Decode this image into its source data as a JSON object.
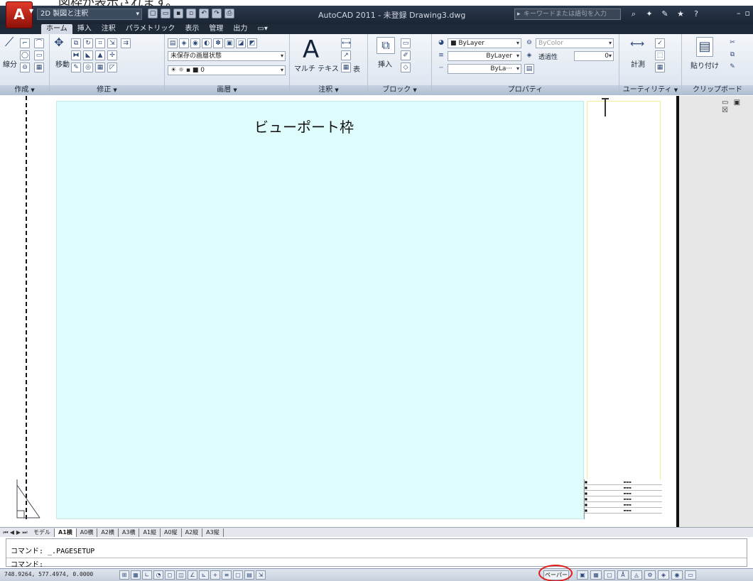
{
  "caption": "図枠が表示されます。",
  "titlebar": {
    "workspace": "2D 製図と注釈",
    "title": "AutoCAD 2011 - 未登録   Drawing3.dwg",
    "search_placeholder": "キーワードまたは語句を入力",
    "app_button": "A"
  },
  "tabs": [
    "ホーム",
    "挿入",
    "注釈",
    "パラメトリック",
    "表示",
    "管理",
    "出力"
  ],
  "ribbon": {
    "draw_panel": "作成",
    "draw_line": "線分",
    "modify_panel": "修正",
    "move": "移動",
    "layers_panel": "画層",
    "layer_state": "未保存の画層状態",
    "layer_current": "0",
    "annotation_panel": "注釈",
    "mtext": "マルチ テキスト",
    "table": "表",
    "block_panel": "ブロック",
    "insert": "挿入",
    "properties_panel": "プロパティ",
    "color": "ByLayer",
    "bycolor": "ByColor",
    "lineweight": "ByLayer",
    "linetype": "ByLa···",
    "transparency": "透過性",
    "transparency_value": "0",
    "utilities_panel": "ユーティリティ",
    "measure": "計測",
    "clipboard_panel": "クリップボード",
    "paste": "貼り付け"
  },
  "drawing": {
    "viewport_label": "ビューポート枠",
    "viewport_controls": "▭ ▣ ☒"
  },
  "layout_tabs": [
    "モデル",
    "A1横",
    "A0横",
    "A2横",
    "A3横",
    "A1縦",
    "A0縦",
    "A2縦",
    "A3縦"
  ],
  "active_layout": "A1横",
  "command": {
    "history": "コマンド:  _.PAGESETUP",
    "prompt": "コマンド:"
  },
  "status": {
    "coords": "748.9264, 577.4974, 0.0000",
    "paper_model": "ペーパー"
  }
}
